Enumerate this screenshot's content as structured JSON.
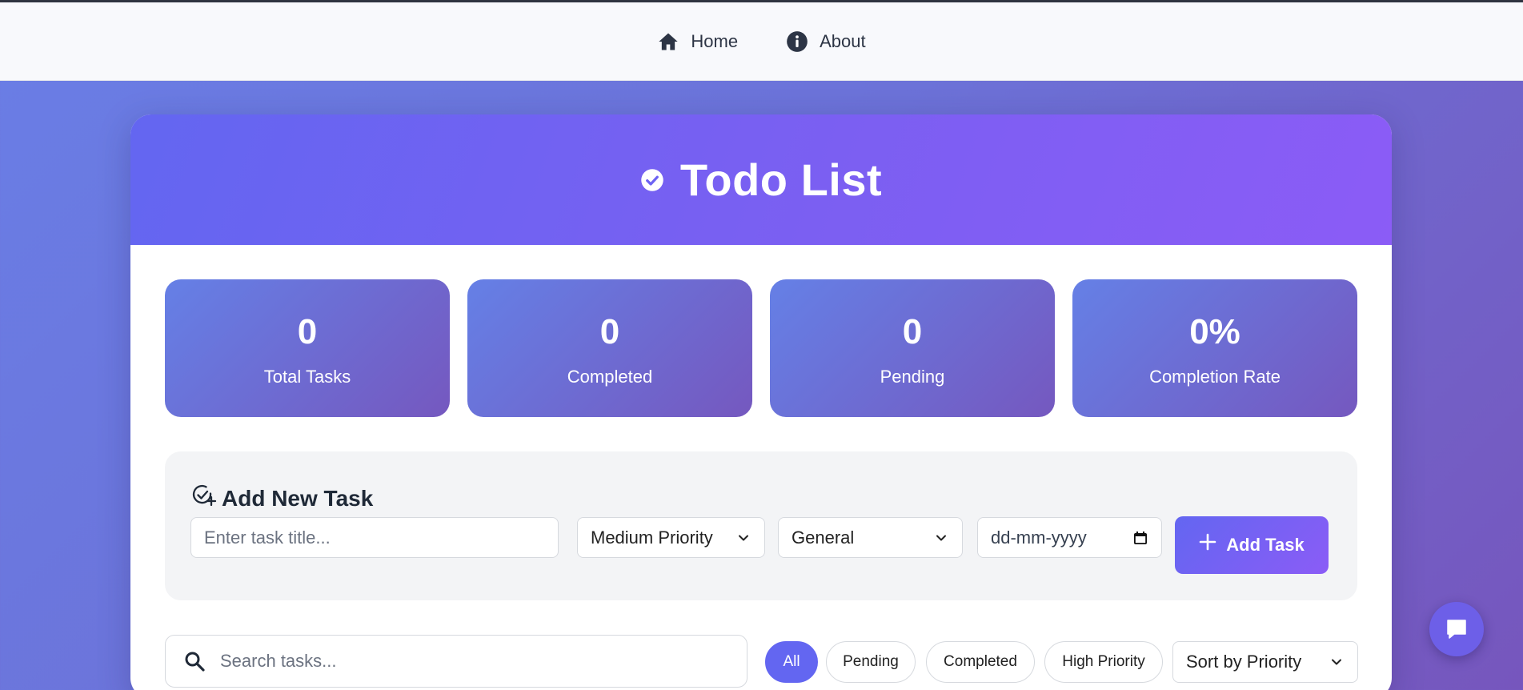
{
  "nav": {
    "items": [
      {
        "label": "Home",
        "icon": "home-icon"
      },
      {
        "label": "About",
        "icon": "info-icon"
      }
    ]
  },
  "header": {
    "title": "Todo List",
    "icon": "check-circle-icon"
  },
  "stats": [
    {
      "value": "0",
      "label": "Total Tasks"
    },
    {
      "value": "0",
      "label": "Completed"
    },
    {
      "value": "0",
      "label": "Pending"
    },
    {
      "value": "0%",
      "label": "Completion Rate"
    }
  ],
  "add_task": {
    "title": "Add New Task",
    "title_icon": "check-circle-plus-icon",
    "title_placeholder": "Enter task title...",
    "priority_value": "Medium Priority",
    "category_value": "General",
    "date_placeholder": "dd-mm-yyyy",
    "button_label": "Add Task"
  },
  "search": {
    "placeholder": "Search tasks..."
  },
  "filters": [
    "All",
    "Pending",
    "Completed",
    "High Priority"
  ],
  "active_filter": "All",
  "sort": {
    "value": "Sort by Priority"
  },
  "colors": {
    "accent": "#6366f1",
    "accent_end": "#8b5cf6",
    "stat_start": "#6580e6",
    "stat_end": "#7558bf",
    "chat_button": "#6d5fe8"
  }
}
